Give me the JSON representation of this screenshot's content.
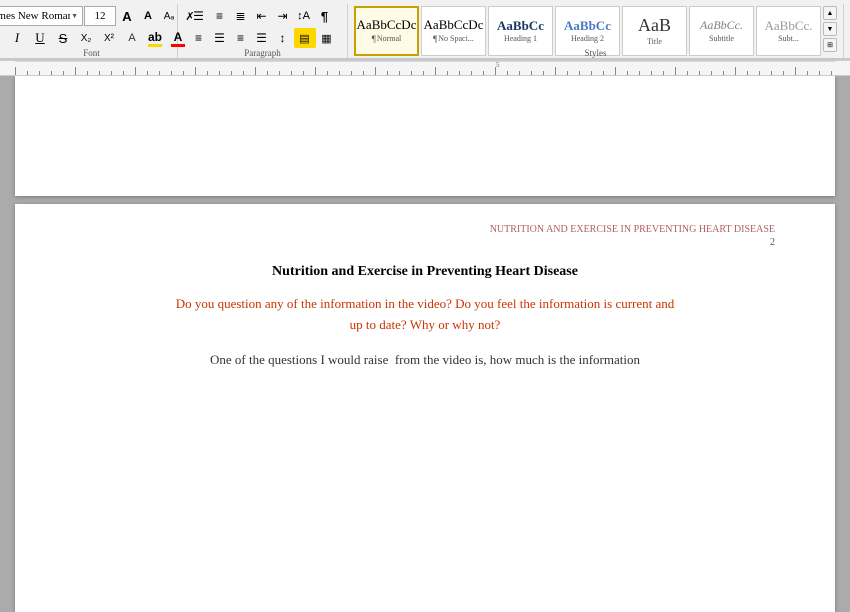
{
  "ribbon": {
    "font": {
      "name": "Times New Roman",
      "size": "12",
      "label": "Font"
    },
    "paragraph": {
      "label": "Paragraph"
    },
    "styles": {
      "label": "Styles",
      "items": [
        {
          "id": "normal",
          "preview": "AaBbCcDc",
          "sublabel": "¶ Normal",
          "active": true
        },
        {
          "id": "no-spacing",
          "preview": "AaBbCcDc",
          "sublabel": "¶ No Spaci...",
          "active": false
        },
        {
          "id": "heading1",
          "preview": "AaBbCc",
          "sublabel": "Heading 1",
          "active": false
        },
        {
          "id": "heading2",
          "preview": "AaBbCc",
          "sublabel": "Heading 2",
          "active": false
        },
        {
          "id": "title",
          "preview": "AaB",
          "sublabel": "Title",
          "active": false
        },
        {
          "id": "subtitle",
          "preview": "AaBbCc.",
          "sublabel": "Subtitle",
          "active": false
        },
        {
          "id": "more",
          "preview": "Aa",
          "sublabel": "Subt...",
          "active": false
        }
      ]
    }
  },
  "ruler": {
    "visible": true
  },
  "page2": {
    "header": "NUTRITION AND EXERCISE IN PREVENTING HEART DISEASE",
    "page_number": "2",
    "title": "Nutrition and Exercise in Preventing Heart Disease",
    "question": "Do you question any of the information in the video? Do you feel the information is current and\nup to date? Why or why not?",
    "body_text": "One of the questions I would raise  from the video is, how much is the information"
  }
}
